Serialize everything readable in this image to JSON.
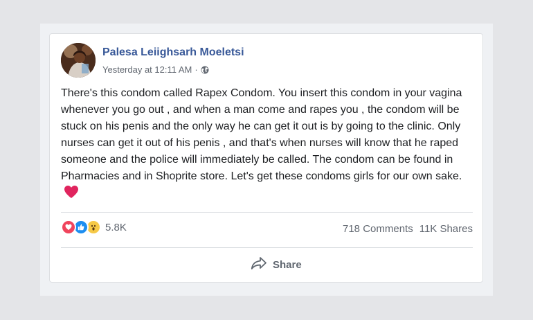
{
  "post": {
    "author": "Palesa Leiighsarh Moeletsi",
    "timestamp": "Yesterday at 12:11 AM",
    "separator": "·",
    "privacy_icon": "globe-icon",
    "text": "There's this condom called Rapex Condom. You insert this condom in your vagina whenever you go out , and when a man come and rapes you , the condom will be stuck on his penis and the only way he can get it out is by going to the clinic. Only nurses can get it out of his penis , and that's when nurses will know that he raped someone and the police will immediately be called. The condom can be found in Pharmacies and in Shoprite store. Let's get these condoms girls for our own sake.",
    "trailing_emoji": "red-heart-icon"
  },
  "reactions": {
    "icons": [
      "love-reaction-icon",
      "like-reaction-icon",
      "wow-reaction-icon"
    ],
    "count": "5.8K"
  },
  "stats": {
    "comments": "718 Comments",
    "shares": "11K Shares"
  },
  "actions": {
    "share_label": "Share",
    "share_icon": "share-arrow-icon"
  },
  "colors": {
    "author_link": "#385898",
    "love": "#f0445c",
    "like": "#1d8ef0",
    "wow": "#f6c947",
    "heart": "#e0245e"
  }
}
